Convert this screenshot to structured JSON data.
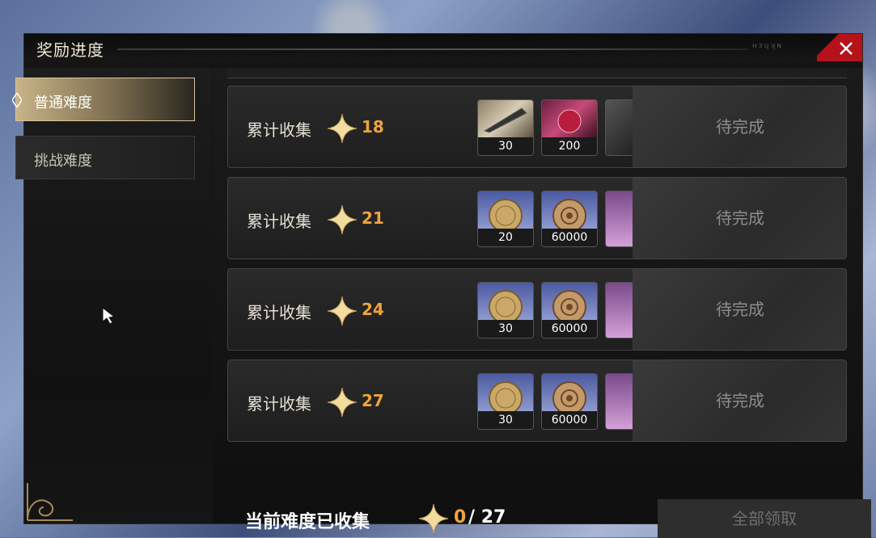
{
  "window": {
    "title": "奖励进度",
    "title_deco": "ʜɜɥʞɴ"
  },
  "sidebar": {
    "tabs": [
      {
        "label": "普通难度",
        "active": true
      },
      {
        "label": "挑战难度",
        "active": false
      }
    ]
  },
  "rows": [
    {
      "label": "累计收集",
      "count": "18",
      "rewards": [
        {
          "qty": "30",
          "icon": "feather-quill-icon"
        },
        {
          "qty": "200",
          "icon": "red-crystal-icon"
        }
      ],
      "status": "待完成"
    },
    {
      "label": "累计收集",
      "count": "21",
      "rewards": [
        {
          "qty": "20",
          "icon": "gold-coin-icon"
        },
        {
          "qty": "60000",
          "icon": "bronze-coin-icon"
        }
      ],
      "status": "待完成"
    },
    {
      "label": "累计收集",
      "count": "24",
      "rewards": [
        {
          "qty": "30",
          "icon": "gold-coin-icon"
        },
        {
          "qty": "60000",
          "icon": "bronze-coin-icon"
        }
      ],
      "status": "待完成"
    },
    {
      "label": "累计收集",
      "count": "27",
      "rewards": [
        {
          "qty": "30",
          "icon": "gold-coin-icon"
        },
        {
          "qty": "60000",
          "icon": "bronze-coin-icon"
        }
      ],
      "status": "待完成"
    }
  ],
  "footer": {
    "label": "当前难度已收集",
    "current": "0",
    "total": "/ 27",
    "claim_all": "全部领取"
  },
  "colors": {
    "accent_orange": "#f0a33c",
    "close_red": "#b5121b",
    "tab_gold": "#c8b488"
  }
}
